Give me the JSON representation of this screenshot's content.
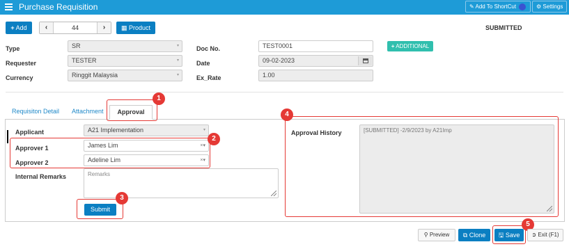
{
  "header": {
    "title": "Purchase Requisition",
    "shortcut_label": "Add To ShortCut",
    "settings_label": "Settings"
  },
  "toolbar": {
    "add_label": "Add",
    "record_number": "44",
    "product_label": "Product",
    "status": "SUBMITTED"
  },
  "form": {
    "type_label": "Type",
    "type_value": "SR",
    "requester_label": "Requester",
    "requester_value": "TESTER",
    "currency_label": "Currency",
    "currency_value": "Ringgit Malaysia",
    "docno_label": "Doc No.",
    "docno_value": "TEST0001",
    "date_label": "Date",
    "date_value": "09-02-2023",
    "exrate_label": "Ex_Rate",
    "exrate_value": "1.00",
    "additional_label": "ADDITIONAL"
  },
  "tabs": [
    {
      "label": "Requisiton Detail"
    },
    {
      "label": "Attachment"
    },
    {
      "label": "Approval"
    }
  ],
  "approval": {
    "applicant_label": "Applicant",
    "applicant_value": "A21 Implementation",
    "approver1_label": "Approver 1",
    "approver1_value": "James Lim",
    "approver2_label": "Approver 2",
    "approver2_value": "Adeline Lim",
    "remarks_label": "Internal Remarks",
    "remarks_placeholder": "Remarks",
    "submit_label": "Submit",
    "history_label": "Approval History",
    "history_text": "[SUBMITTED] -2/9/2023 by A21Imp"
  },
  "annotations": [
    "1",
    "2",
    "3",
    "4",
    "5"
  ],
  "footer": {
    "preview_label": "Preview",
    "clone_label": "Clone",
    "save_label": "Save",
    "exit_label": "Exit (F1)"
  }
}
